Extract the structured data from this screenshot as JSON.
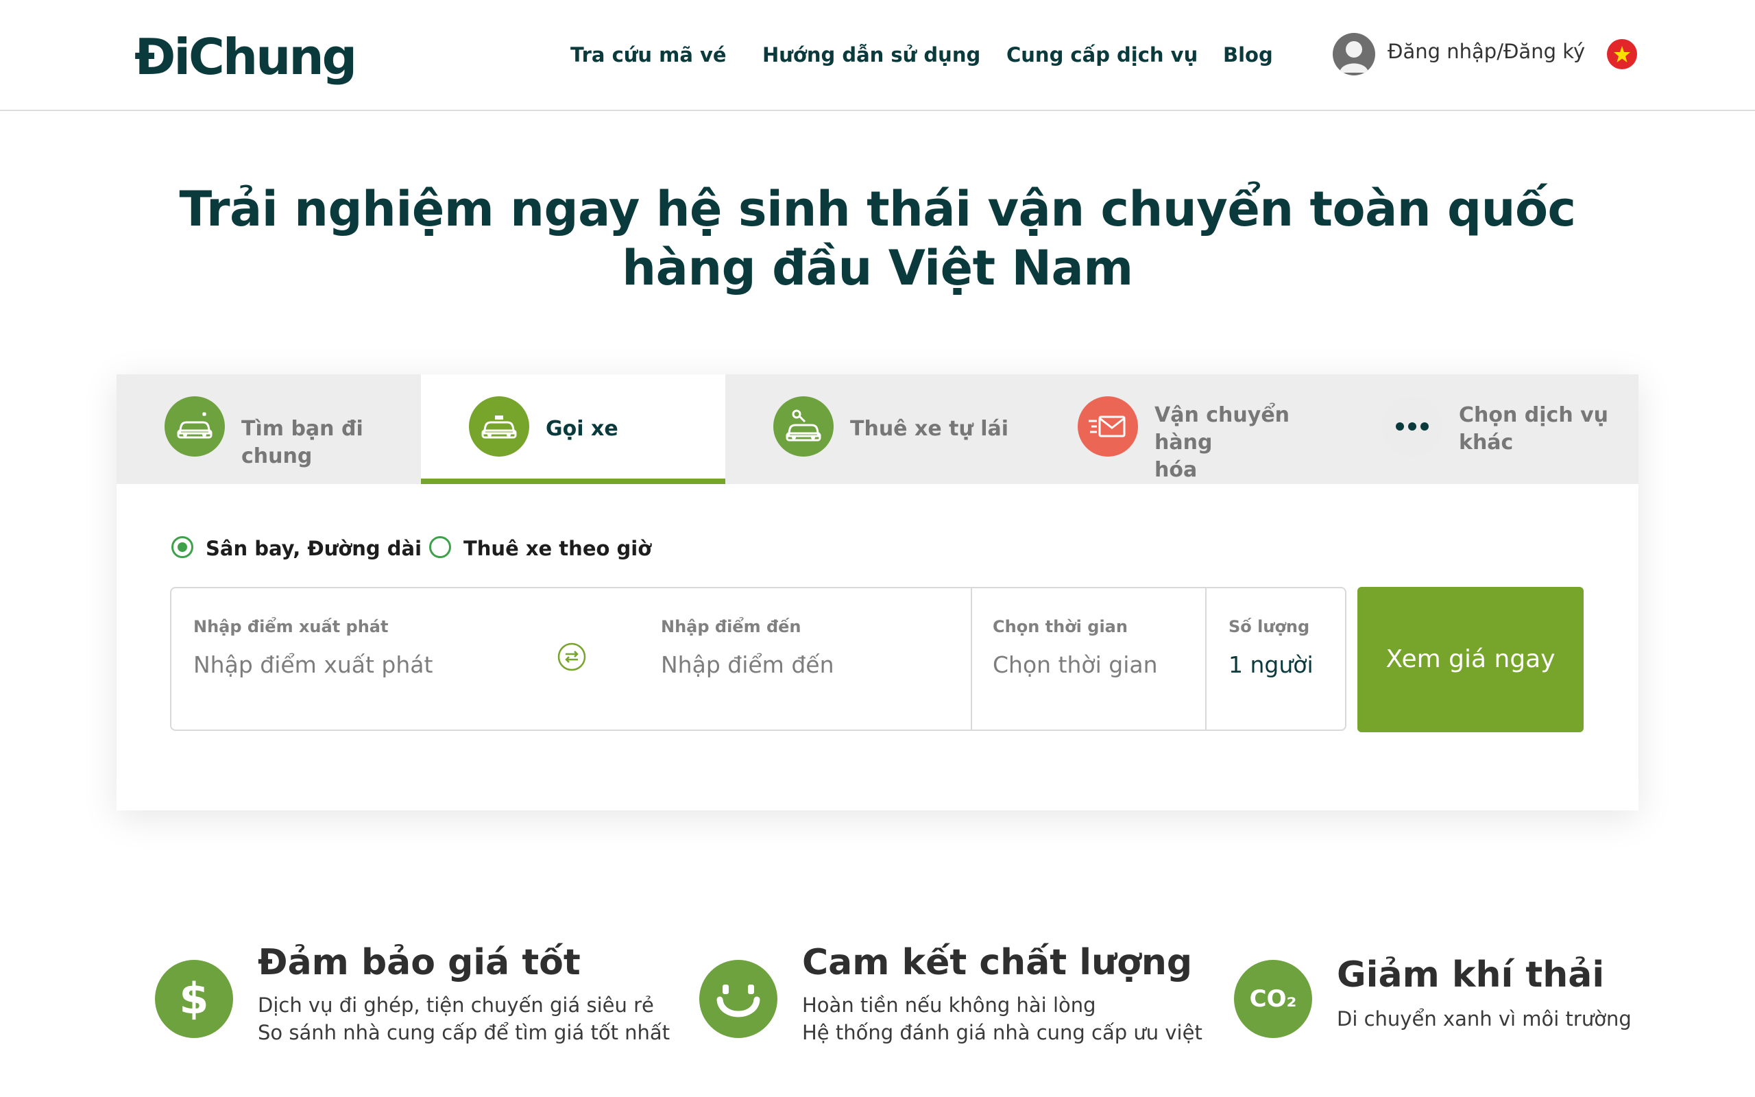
{
  "header": {
    "logo": "ĐiChung",
    "nav": [
      "Tra cứu mã vé",
      "Hướng dẫn sử dụng",
      "Cung cấp dịch vụ",
      "Blog"
    ],
    "login_label": "Đăng nhập/Đăng ký",
    "language_flag": "vietnam-flag-icon"
  },
  "hero": {
    "line1": "Trải nghiệm ngay hệ sinh thái vận chuyển toàn quốc",
    "line2": "hàng đầu Việt Nam"
  },
  "tabs": [
    {
      "label": "Tìm bạn đi chung",
      "icon": "carpool-car-icon",
      "color": "#6da23e",
      "active": false
    },
    {
      "label": "Gọi xe",
      "icon": "taxi-icon",
      "color": "#77a42b",
      "active": true
    },
    {
      "label": "Thuê xe tự lái",
      "icon": "self-drive-car-icon",
      "color": "#6da23e",
      "active": false
    },
    {
      "label_line1": "Vận chuyển hàng",
      "label_line2": "hóa",
      "icon": "delivery-envelope-icon",
      "color": "#ec6656",
      "active": false
    },
    {
      "label_line1": "Chọn dịch vụ",
      "label_line2": "khác",
      "icon": "more-dots-icon",
      "color": "#ececec",
      "active": false
    }
  ],
  "trip_type": {
    "options": [
      "Sân bay, Đường dài",
      "Thuê xe theo giờ"
    ],
    "selected_index": 0
  },
  "search": {
    "from_label": "Nhập điểm xuất phát",
    "from_placeholder": "Nhập điểm xuất phát",
    "to_label": "Nhập điểm đến",
    "to_placeholder": "Nhập điểm đến",
    "time_label": "Chọn thời gian",
    "time_placeholder": "Chọn thời gian",
    "quantity_label": "Số lượng",
    "quantity_value": "1 người",
    "submit_label": "Xem giá ngay"
  },
  "features": [
    {
      "title": "Đảm bảo giá tốt",
      "lines": [
        "Dịch vụ đi ghép, tiện chuyến giá siêu rẻ",
        "So sánh nhà cung cấp để tìm giá tốt nhất"
      ],
      "icon": "dollar-icon"
    },
    {
      "title": "Cam kết chất lượng",
      "lines": [
        "Hoàn tiền nếu không hài lòng",
        "Hệ thống đánh giá nhà cung cấp ưu việt"
      ],
      "icon": "smile-icon"
    },
    {
      "title": "Giảm khí thải",
      "lines": [
        "Di chuyển xanh vì môi trường"
      ],
      "icon": "co2-icon",
      "icon_text": "CO₂"
    }
  ],
  "colors": {
    "brand_dark": "#0b3a3d",
    "accent_green": "#77a42b",
    "feature_green": "#6da23e",
    "delivery_red": "#ec6656"
  }
}
